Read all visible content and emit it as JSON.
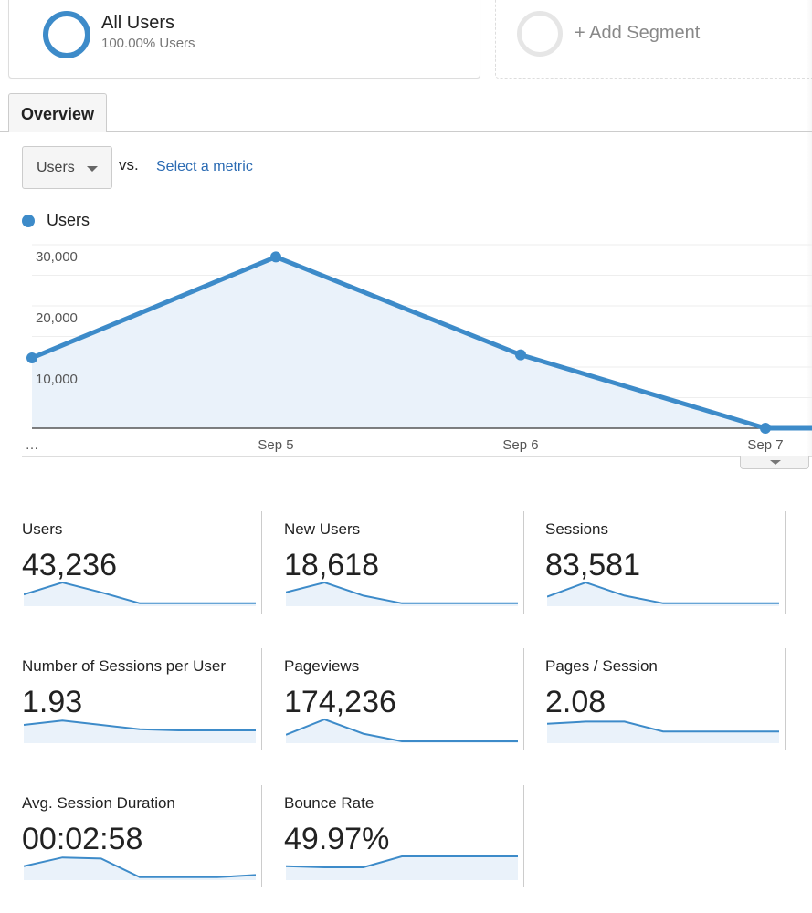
{
  "segments": {
    "active": {
      "name": "All Users",
      "subtitle": "100.00% Users",
      "color": "#3d8bc9"
    },
    "add_label": "+ Add Segment"
  },
  "tabs": [
    {
      "label": "Overview",
      "active": true
    }
  ],
  "controls": {
    "metric_select": "Users",
    "vs_label": "vs.",
    "compare_link": "Select a metric"
  },
  "legend": {
    "label": "Users",
    "color": "#3d8bc9"
  },
  "chart_data": {
    "type": "area",
    "title": "",
    "xlabel": "",
    "ylabel": "",
    "series": [
      {
        "name": "Users",
        "color": "#3d8bc9",
        "values": [
          11500,
          28000,
          12000,
          0,
          0
        ]
      }
    ],
    "x": [
      "…",
      "Sep 5",
      "Sep 6",
      "Sep 7",
      ""
    ],
    "x_tick_labels": [
      "…",
      "Sep 5",
      "Sep 6",
      "Sep 7"
    ],
    "y_tick_labels": [
      "10,000",
      "20,000",
      "30,000"
    ],
    "y_ticks": [
      10000,
      20000,
      30000
    ],
    "ylim": [
      0,
      30000
    ],
    "grid": true,
    "legend": "top-left"
  },
  "scorecards": [
    {
      "label": "Users",
      "value": "43,236",
      "spark": [
        0.45,
        1.0,
        0.55,
        0.05,
        0.05,
        0.05,
        0.05
      ]
    },
    {
      "label": "New Users",
      "value": "18,618",
      "spark": [
        0.55,
        1.0,
        0.4,
        0.05,
        0.05,
        0.05,
        0.05
      ]
    },
    {
      "label": "Sessions",
      "value": "83,581",
      "spark": [
        0.35,
        1.0,
        0.4,
        0.05,
        0.05,
        0.05,
        0.05
      ]
    },
    {
      "label": "Number of Sessions per User",
      "value": "1.93",
      "spark": [
        0.75,
        0.95,
        0.75,
        0.55,
        0.5,
        0.5,
        0.5
      ]
    },
    {
      "label": "Pageviews",
      "value": "174,236",
      "spark": [
        0.3,
        1.0,
        0.35,
        0.0,
        0.0,
        0.0,
        0.0
      ]
    },
    {
      "label": "Pages / Session",
      "value": "2.08",
      "spark": [
        0.8,
        0.9,
        0.9,
        0.45,
        0.45,
        0.45,
        0.45
      ]
    },
    {
      "label": "Avg. Session Duration",
      "value": "00:02:58",
      "spark": [
        0.55,
        0.95,
        0.9,
        0.05,
        0.05,
        0.05,
        0.15
      ]
    },
    {
      "label": "Bounce Rate",
      "value": "49.97%",
      "spark": [
        0.55,
        0.5,
        0.5,
        1.0,
        1.0,
        1.0,
        1.0
      ]
    }
  ]
}
